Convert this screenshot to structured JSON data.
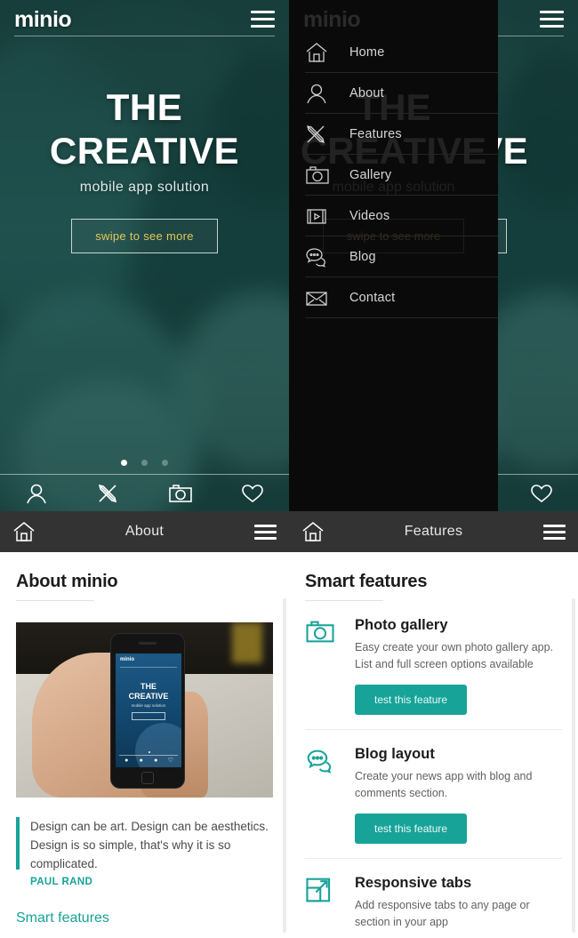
{
  "brand": {
    "name": "minio"
  },
  "hero": {
    "title_line1": "THE",
    "title_line2": "CREATIVE",
    "subtitle": "mobile app solution",
    "cta_label": "swipe to see more",
    "dots": [
      "active",
      "inactive",
      "inactive"
    ],
    "tabbar": [
      "person-icon",
      "tools-icon",
      "camera-icon",
      "heart-icon"
    ]
  },
  "menu": {
    "items": [
      {
        "label": "Home",
        "icon": "home-icon"
      },
      {
        "label": "About",
        "icon": "person-icon"
      },
      {
        "label": "Features",
        "icon": "tools-icon"
      },
      {
        "label": "Gallery",
        "icon": "camera-icon"
      },
      {
        "label": "Videos",
        "icon": "video-icon"
      },
      {
        "label": "Blog",
        "icon": "chat-icon"
      },
      {
        "label": "Contact",
        "icon": "envelope-icon"
      }
    ]
  },
  "about": {
    "header_title": "About",
    "section_title": "About minio",
    "quote": "Design can be art. Design can be aesthetics. Design is so simple, that's why it is so complicated.",
    "quote_author": "PAUL RAND",
    "link_label": "Smart features"
  },
  "features": {
    "header_title": "Features",
    "section_title": "Smart features",
    "items": [
      {
        "title": "Photo gallery",
        "desc": "Easy create your own photo gallery app. List and full screen options available",
        "button": "test this feature",
        "icon": "camera-icon"
      },
      {
        "title": "Blog layout",
        "desc": "Create your news app with blog and comments section.",
        "button": "test this feature",
        "icon": "chat-icon"
      },
      {
        "title": "Responsive tabs",
        "desc": "Add responsive tabs to any page or section in your app",
        "button": "",
        "icon": "expand-icon"
      }
    ]
  },
  "phone_mockup": {
    "logo": "minio",
    "title_line1": "THE",
    "title_line2": "CREATIVE",
    "subtitle": "mobile app solution",
    "tabbar": [
      "person-icon",
      "tools-icon",
      "camera-icon",
      "heart-icon"
    ]
  },
  "colors": {
    "accent_teal": "#17a398",
    "hero_teal": "#1d4a46",
    "cta_gold": "#e3c85c",
    "header_dark": "#333334",
    "menu_black": "#0a0a0a"
  }
}
